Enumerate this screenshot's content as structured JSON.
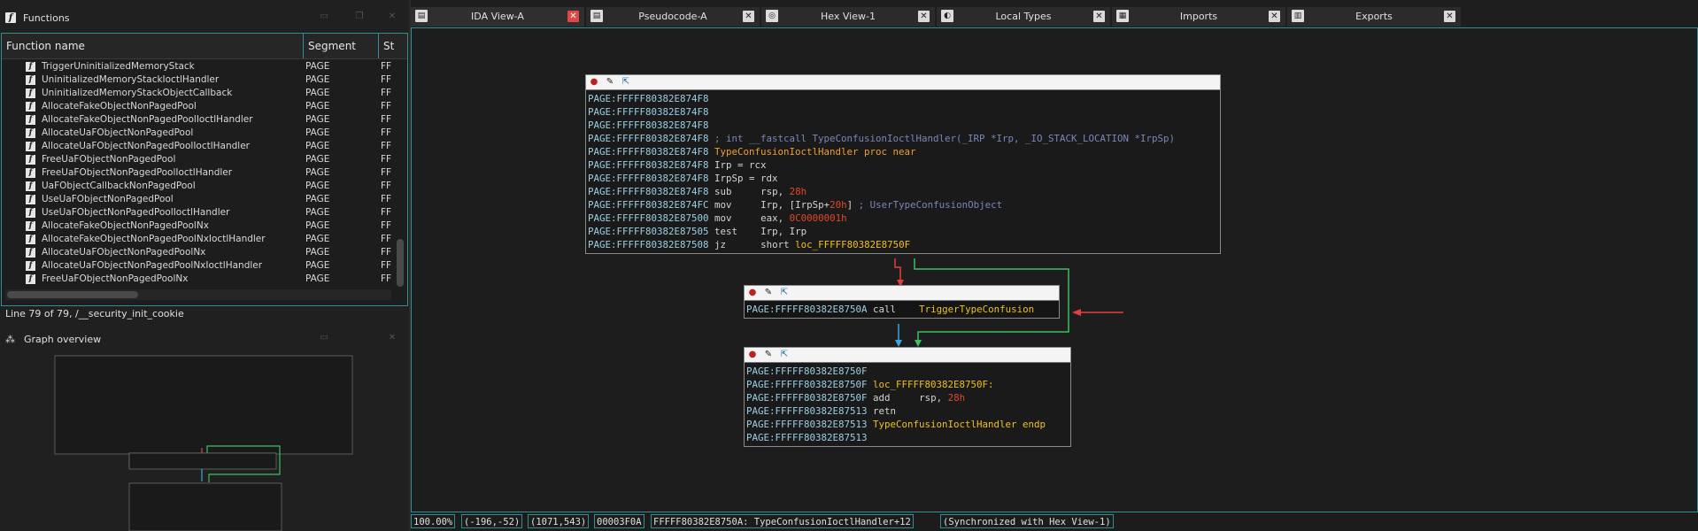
{
  "functions_panel": {
    "title": "Functions",
    "columns": [
      "Function name",
      "Segment",
      "St"
    ],
    "rows": [
      {
        "name": "TriggerUninitializedMemoryStack",
        "segment": "PAGE",
        "st": "FF"
      },
      {
        "name": "UninitializedMemoryStackIoctlHandler",
        "segment": "PAGE",
        "st": "FF"
      },
      {
        "name": "UninitializedMemoryStackObjectCallback",
        "segment": "PAGE",
        "st": "FF"
      },
      {
        "name": "AllocateFakeObjectNonPagedPool",
        "segment": "PAGE",
        "st": "FF"
      },
      {
        "name": "AllocateFakeObjectNonPagedPoolIoctlHandler",
        "segment": "PAGE",
        "st": "FF"
      },
      {
        "name": "AllocateUaFObjectNonPagedPool",
        "segment": "PAGE",
        "st": "FF"
      },
      {
        "name": "AllocateUaFObjectNonPagedPoolIoctlHandler",
        "segment": "PAGE",
        "st": "FF"
      },
      {
        "name": "FreeUaFObjectNonPagedPool",
        "segment": "PAGE",
        "st": "FF"
      },
      {
        "name": "FreeUaFObjectNonPagedPoolIoctlHandler",
        "segment": "PAGE",
        "st": "FF"
      },
      {
        "name": "UaFObjectCallbackNonPagedPool",
        "segment": "PAGE",
        "st": "FF"
      },
      {
        "name": "UseUaFObjectNonPagedPool",
        "segment": "PAGE",
        "st": "FF"
      },
      {
        "name": "UseUaFObjectNonPagedPoolIoctlHandler",
        "segment": "PAGE",
        "st": "FF"
      },
      {
        "name": "AllocateFakeObjectNonPagedPoolNx",
        "segment": "PAGE",
        "st": "FF"
      },
      {
        "name": "AllocateFakeObjectNonPagedPoolNxIoctlHandler",
        "segment": "PAGE",
        "st": "FF"
      },
      {
        "name": "AllocateUaFObjectNonPagedPoolNx",
        "segment": "PAGE",
        "st": "FF"
      },
      {
        "name": "AllocateUaFObjectNonPagedPoolNxIoctlHandler",
        "segment": "PAGE",
        "st": "FF"
      },
      {
        "name": "FreeUaFObjectNonPagedPoolNx",
        "segment": "PAGE",
        "st": "FF"
      }
    ],
    "status": "Line 79 of 79, /__security_init_cookie"
  },
  "overview_panel": {
    "title": "Graph overview"
  },
  "tabs": [
    {
      "label": "IDA View-A",
      "active": true,
      "icon": "list-icon"
    },
    {
      "label": "Pseudocode-A",
      "active": false,
      "icon": "list-icon"
    },
    {
      "label": "Hex View-1",
      "active": false,
      "icon": "hex-icon"
    },
    {
      "label": "Local Types",
      "active": false,
      "icon": "types-icon"
    },
    {
      "label": "Imports",
      "active": false,
      "icon": "imports-icon"
    },
    {
      "label": "Exports",
      "active": false,
      "icon": "exports-icon"
    }
  ],
  "graph": {
    "node1": {
      "lines": [
        {
          "addr": "PAGE:FFFFF80382E874F8",
          "text": ""
        },
        {
          "addr": "PAGE:FFFFF80382E874F8",
          "text": ""
        },
        {
          "addr": "PAGE:FFFFF80382E874F8",
          "text": ""
        },
        {
          "addr": "PAGE:FFFFF80382E874F8",
          "comment": "; int __fastcall TypeConfusionIoctlHandler(_IRP *Irp, _IO_STACK_LOCATION *IrpSp)"
        },
        {
          "addr": "PAGE:FFFFF80382E874F8",
          "name": "TypeConfusionIoctlHandler proc near"
        },
        {
          "addr": "PAGE:FFFFF80382E874F8",
          "text": "Irp = rcx"
        },
        {
          "addr": "PAGE:FFFFF80382E874F8",
          "text": "IrpSp = rdx"
        },
        {
          "addr": "PAGE:FFFFF80382E874F8",
          "mnem": "sub",
          "op1": "rsp, ",
          "num": "28h"
        },
        {
          "addr": "PAGE:FFFFF80382E874FC",
          "mnem": "mov",
          "op1": "Irp, [IrpSp+",
          "num": "20h",
          "op2": "]",
          "comment": " ; UserTypeConfusionObject"
        },
        {
          "addr": "PAGE:FFFFF80382E87500",
          "mnem": "mov",
          "op1": "eax, ",
          "num": "0C0000001h"
        },
        {
          "addr": "PAGE:FFFFF80382E87505",
          "mnem": "test",
          "op1": "Irp, Irp"
        },
        {
          "addr": "PAGE:FFFFF80382E87508",
          "mnem": "jz",
          "op1": "short ",
          "label": "loc_FFFFF80382E8750F"
        }
      ]
    },
    "node2": {
      "lines": [
        {
          "addr": "PAGE:FFFFF80382E8750A",
          "mnem": "call",
          "label": "TriggerTypeConfusion"
        }
      ]
    },
    "node3": {
      "lines": [
        {
          "addr": "PAGE:FFFFF80382E8750F",
          "text": ""
        },
        {
          "addr": "PAGE:FFFFF80382E8750F",
          "label": "loc_FFFFF80382E8750F:"
        },
        {
          "addr": "PAGE:FFFFF80382E8750F",
          "mnem": "add",
          "op1": "rsp, ",
          "num": "28h"
        },
        {
          "addr": "PAGE:FFFFF80382E87513",
          "mnem": "retn"
        },
        {
          "addr": "PAGE:FFFFF80382E87513",
          "label": "TypeConfusionIoctlHandler endp"
        },
        {
          "addr": "PAGE:FFFFF80382E87513",
          "text": ""
        }
      ]
    }
  },
  "statusbar": {
    "zoom": "100.00%",
    "coords": "(-196,-52)",
    "pos": "(1071,543)",
    "offset": "00003F0A",
    "location": "FFFFF80382E8750A: TypeConfusionIoctlHandler+12",
    "sync": "(Synchronized with Hex View-1)"
  },
  "colors": {
    "accent": "#2e8f95",
    "edge_false": "#e04040",
    "edge_true": "#3cc060",
    "edge_uncond": "#3aa8e0",
    "label": "#f0c020",
    "number": "#e04a2a",
    "comment": "#7c86b8",
    "address": "#9ecfe3"
  }
}
